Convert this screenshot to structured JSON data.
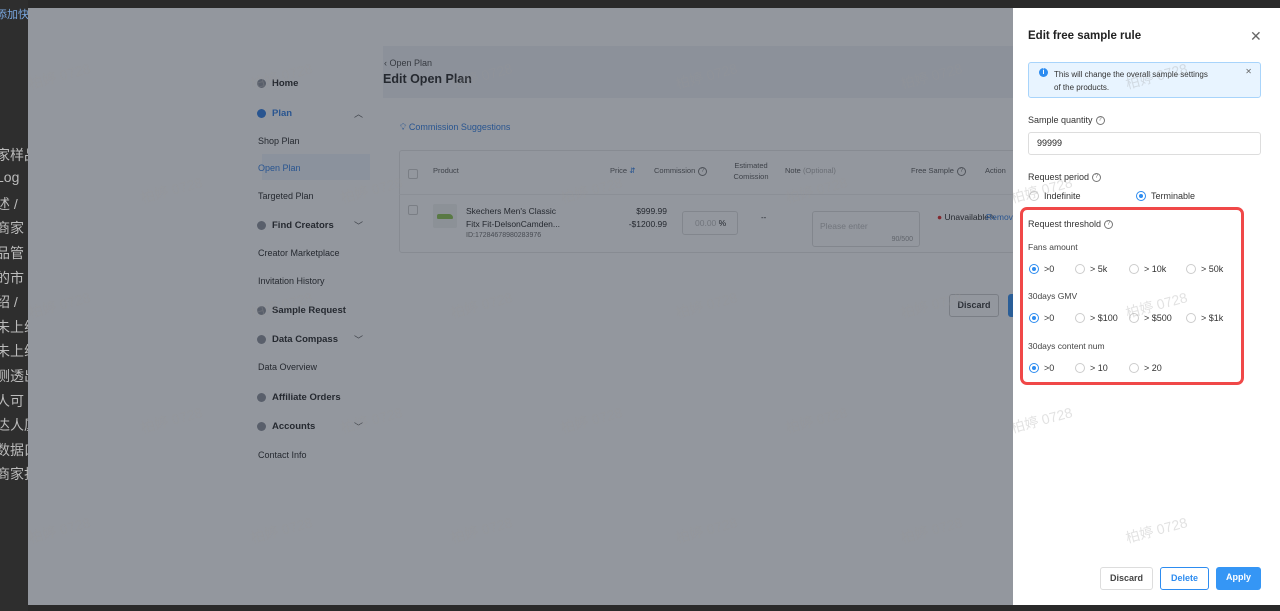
{
  "background_doc": {
    "fragments": [
      "添加快",
      "家样品",
      "Log",
      "述 /",
      "商家",
      "品管",
      "的市",
      "绍 /",
      "未上线",
      "未上线",
      "测透出",
      "人可",
      "达人厦",
      "数据口",
      "商家打"
    ]
  },
  "sidebar": {
    "items": [
      {
        "label": "Home",
        "type": "main",
        "icon": "home-icon"
      },
      {
        "label": "Plan",
        "type": "main",
        "icon": "plan-icon",
        "active": true,
        "chevron": "up"
      },
      {
        "label": "Shop Plan",
        "type": "sub"
      },
      {
        "label": "Open Plan",
        "type": "sub",
        "active": true
      },
      {
        "label": "Targeted Plan",
        "type": "sub"
      },
      {
        "label": "Find Creators",
        "type": "main",
        "icon": "search-people-icon",
        "chevron": "down"
      },
      {
        "label": "Creator Marketplace",
        "type": "sub"
      },
      {
        "label": "Invitation History",
        "type": "sub"
      },
      {
        "label": "Sample Request",
        "type": "main",
        "icon": "box-icon"
      },
      {
        "label": "Data Compass",
        "type": "main",
        "icon": "chart-icon",
        "chevron": "down"
      },
      {
        "label": "Data Overview",
        "type": "sub"
      },
      {
        "label": "Affiliate Orders",
        "type": "main",
        "icon": "orders-icon"
      },
      {
        "label": "Accounts",
        "type": "main",
        "icon": "account-icon",
        "chevron": "down"
      },
      {
        "label": "Contact Info",
        "type": "sub"
      }
    ]
  },
  "main": {
    "breadcrumb": "Open Plan",
    "title": "Edit Open Plan",
    "commission_link": "Commission Suggestions",
    "table": {
      "headers": {
        "product": "Product",
        "price": "Price",
        "commission": "Commission",
        "estimated": "Estimated Comission",
        "note": "Note",
        "note_optional": "(Optional)",
        "free_sample": "Free Sample",
        "action": "Action"
      },
      "row": {
        "name_line1": "Skechers Men's Classic",
        "name_line2": "Fitx Fit-DelsonCamden...",
        "id": "ID:17284678980283976",
        "price_min": "$999.99",
        "price_max": "-$1200.99",
        "commission_placeholder": "00.00",
        "commission_unit": "%",
        "estimated": "--",
        "note_placeholder": "Please enter",
        "note_count": "90/500",
        "free_sample": "Unavailable",
        "action": "Remove"
      }
    },
    "discard": "Discard"
  },
  "drawer": {
    "title": "Edit free sample rule",
    "alert": {
      "line1": "This will change the overall sample settings",
      "line2": "of the products."
    },
    "sample_quantity": {
      "label": "Sample quantity",
      "value": "99999"
    },
    "request_period": {
      "label": "Request period",
      "options": [
        "Indefinite",
        "Terminable"
      ],
      "selected": 1
    },
    "threshold": {
      "label": "Request threshold",
      "highlight_color": "#f04848",
      "groups": [
        {
          "label": "Fans amount",
          "options": [
            ">0",
            "> 5k",
            "> 10k",
            "> 50k"
          ],
          "selected": 0
        },
        {
          "label": "30days GMV",
          "options": [
            ">0",
            "> $100",
            "> $500",
            "> $1k"
          ],
          "selected": 0
        },
        {
          "label": "30days content num",
          "options": [
            ">0",
            "> 10",
            "> 20"
          ],
          "selected": 0
        }
      ]
    },
    "buttons": {
      "discard": "Discard",
      "delete": "Delete",
      "apply": "Apply"
    }
  },
  "colors": {
    "primary": "#2d8cf0",
    "alert_bg": "#e8f4ff",
    "danger": "#e02020"
  },
  "watermark": "柏婷 0728"
}
